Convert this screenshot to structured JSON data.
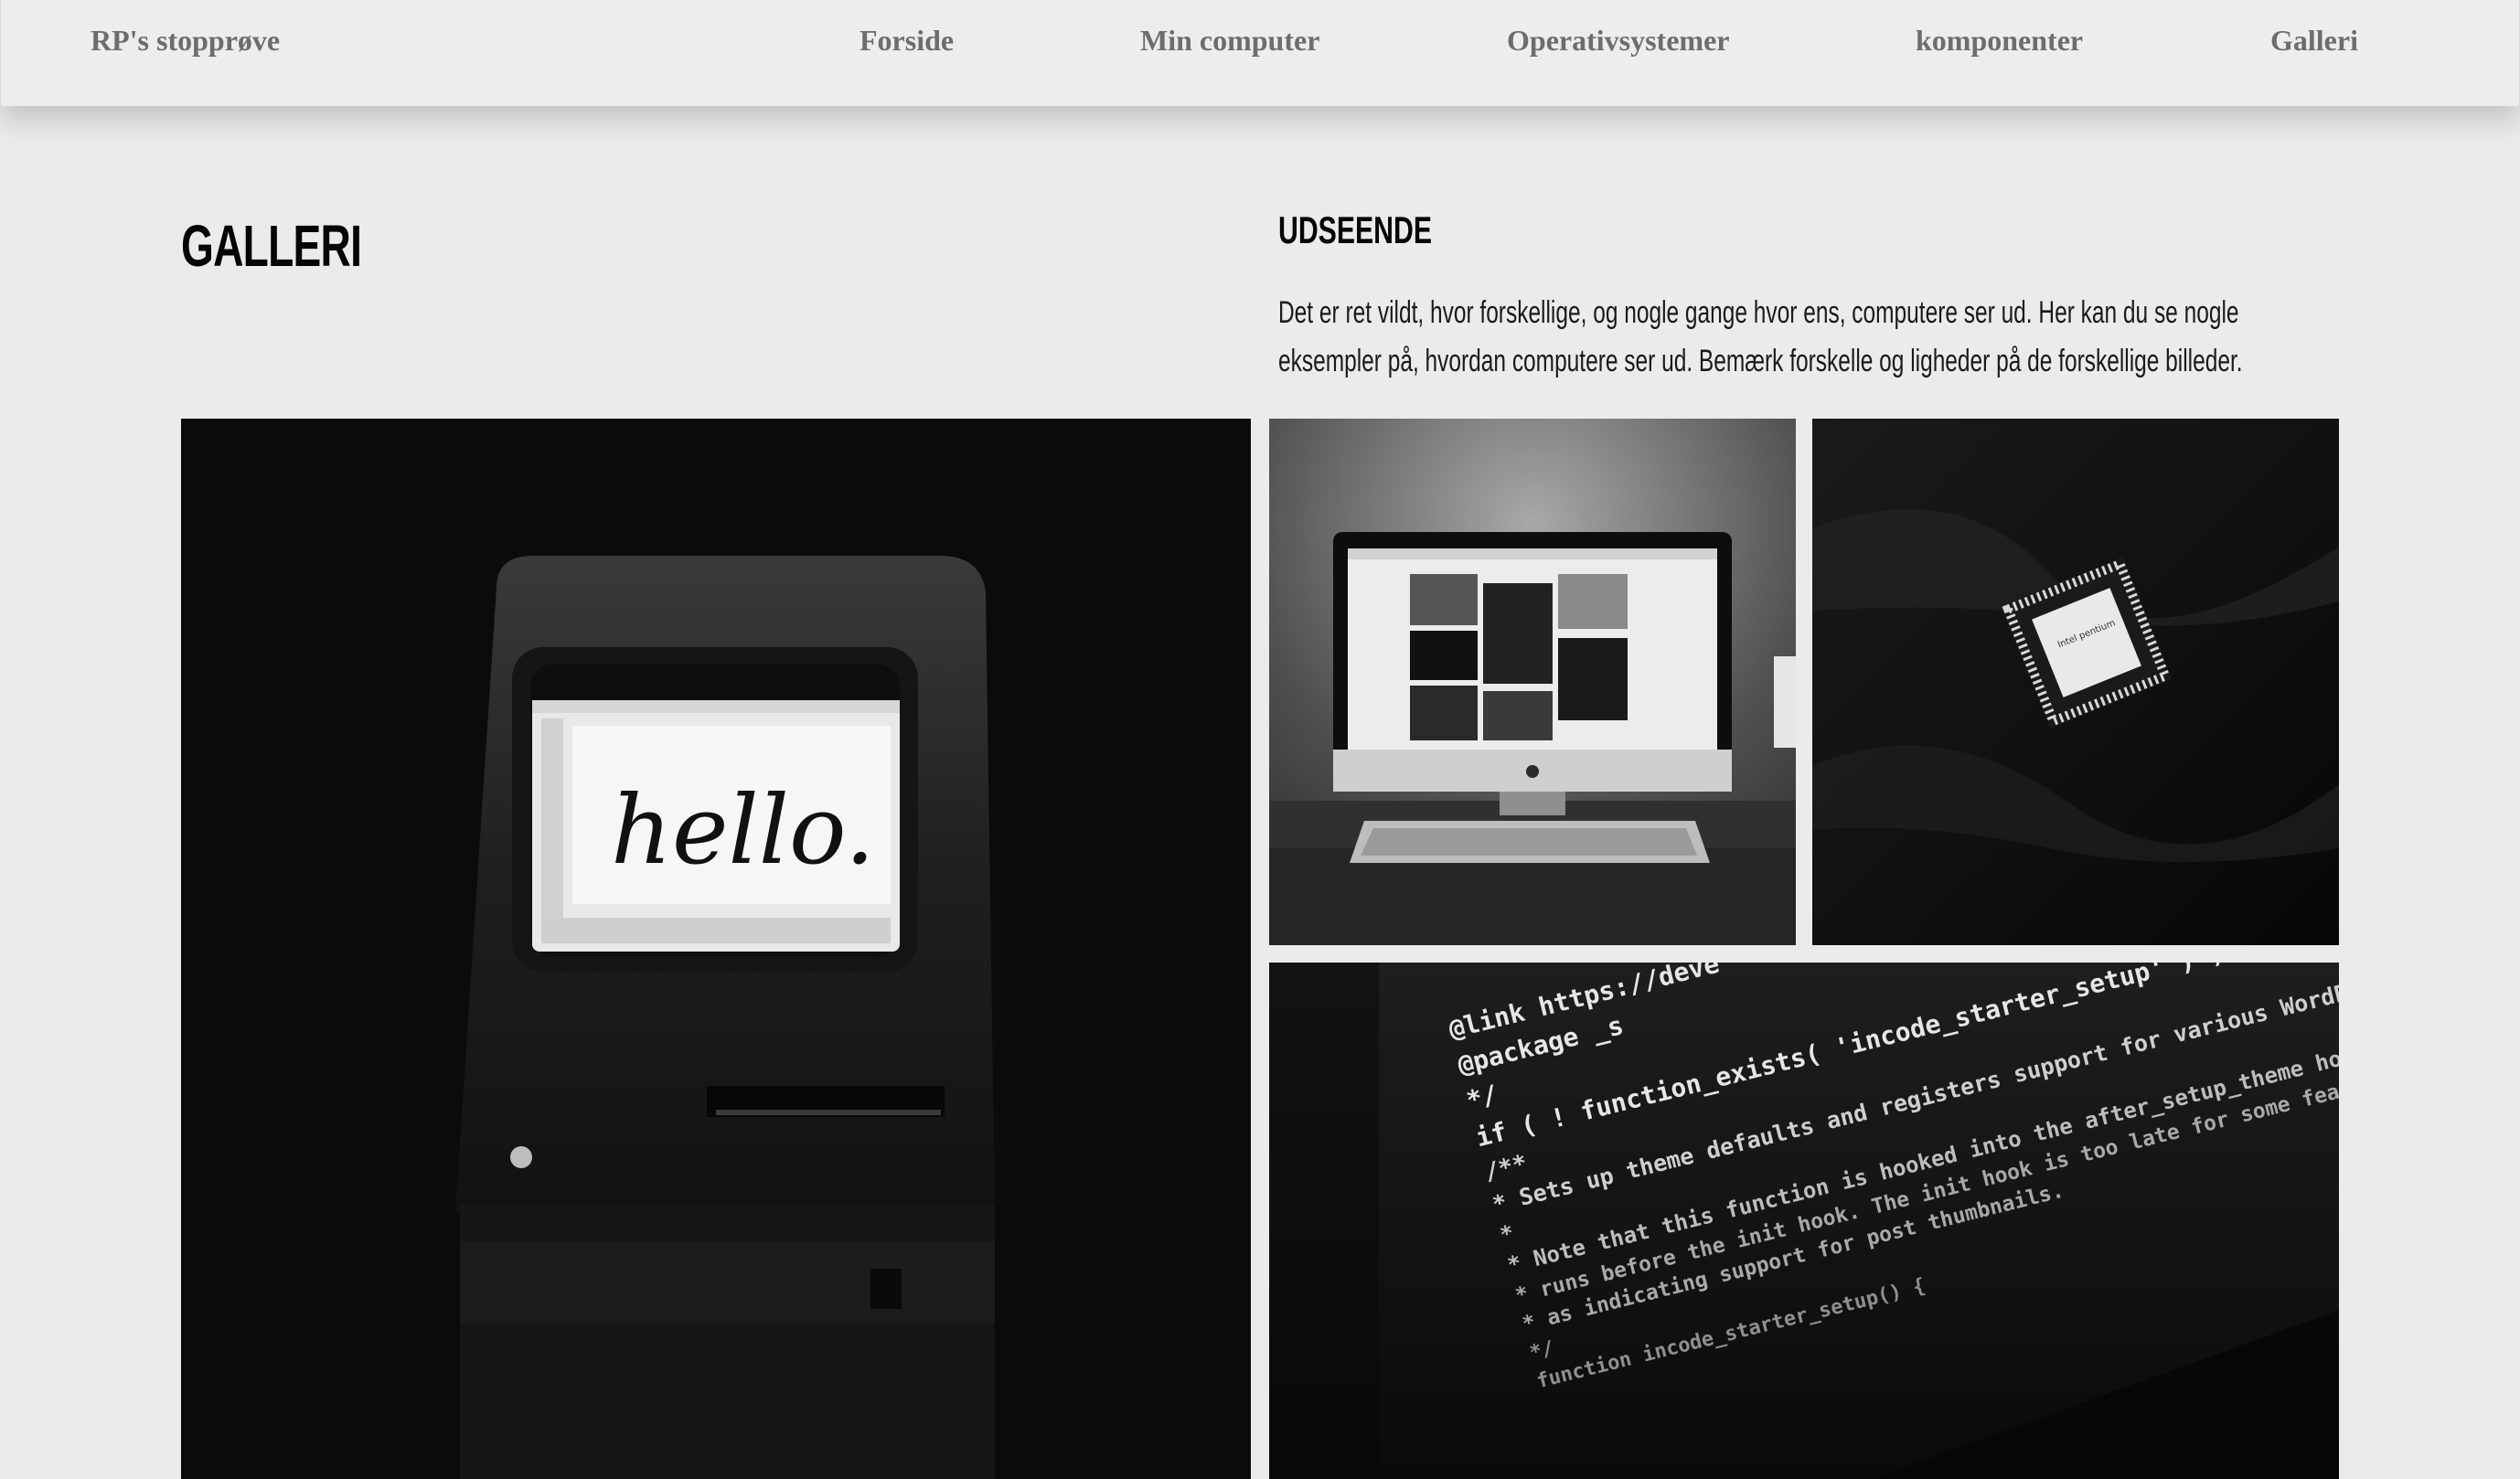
{
  "header": {
    "brand": "RP's stopprøve",
    "nav": [
      {
        "label": "Forside"
      },
      {
        "label": "Min computer"
      },
      {
        "label": "Operativsystemer"
      },
      {
        "label": "komponenter"
      },
      {
        "label": "Galleri"
      }
    ]
  },
  "main": {
    "title": "GALLERI",
    "section": {
      "heading": "UDSEENDE",
      "text": "Det er ret vildt, hvor forskellige, og nogle gange hvor ens, computere ser ud. Her kan du se nogle eksempler på, hvordan computere ser ud. Bemærk forskelle og ligheder på de forskellige billeder."
    }
  },
  "gallery": {
    "mac_screen_text": "hello.",
    "cpu_label": "Intel pentium",
    "code_lines": [
      "@link https://deve",
      "@package _s",
      "*/",
      "if ( ! function_exists( 'incode_starter_setup' ) ) :",
      "/**",
      " * Sets up theme defaults and registers support for various WordPress fea",
      " *",
      " * Note that this function is hooked into the after_setup_theme hook, which",
      " * runs before the init hook. The init hook is too late for some features,",
      " * as indicating support for post thumbnails.",
      " */",
      "function incode_starter_setup() {"
    ]
  },
  "colors": {
    "page_background": "#ebebeb",
    "header_background": "#ededed",
    "nav_text": "#6d6d6d",
    "heading_text": "#050505"
  }
}
